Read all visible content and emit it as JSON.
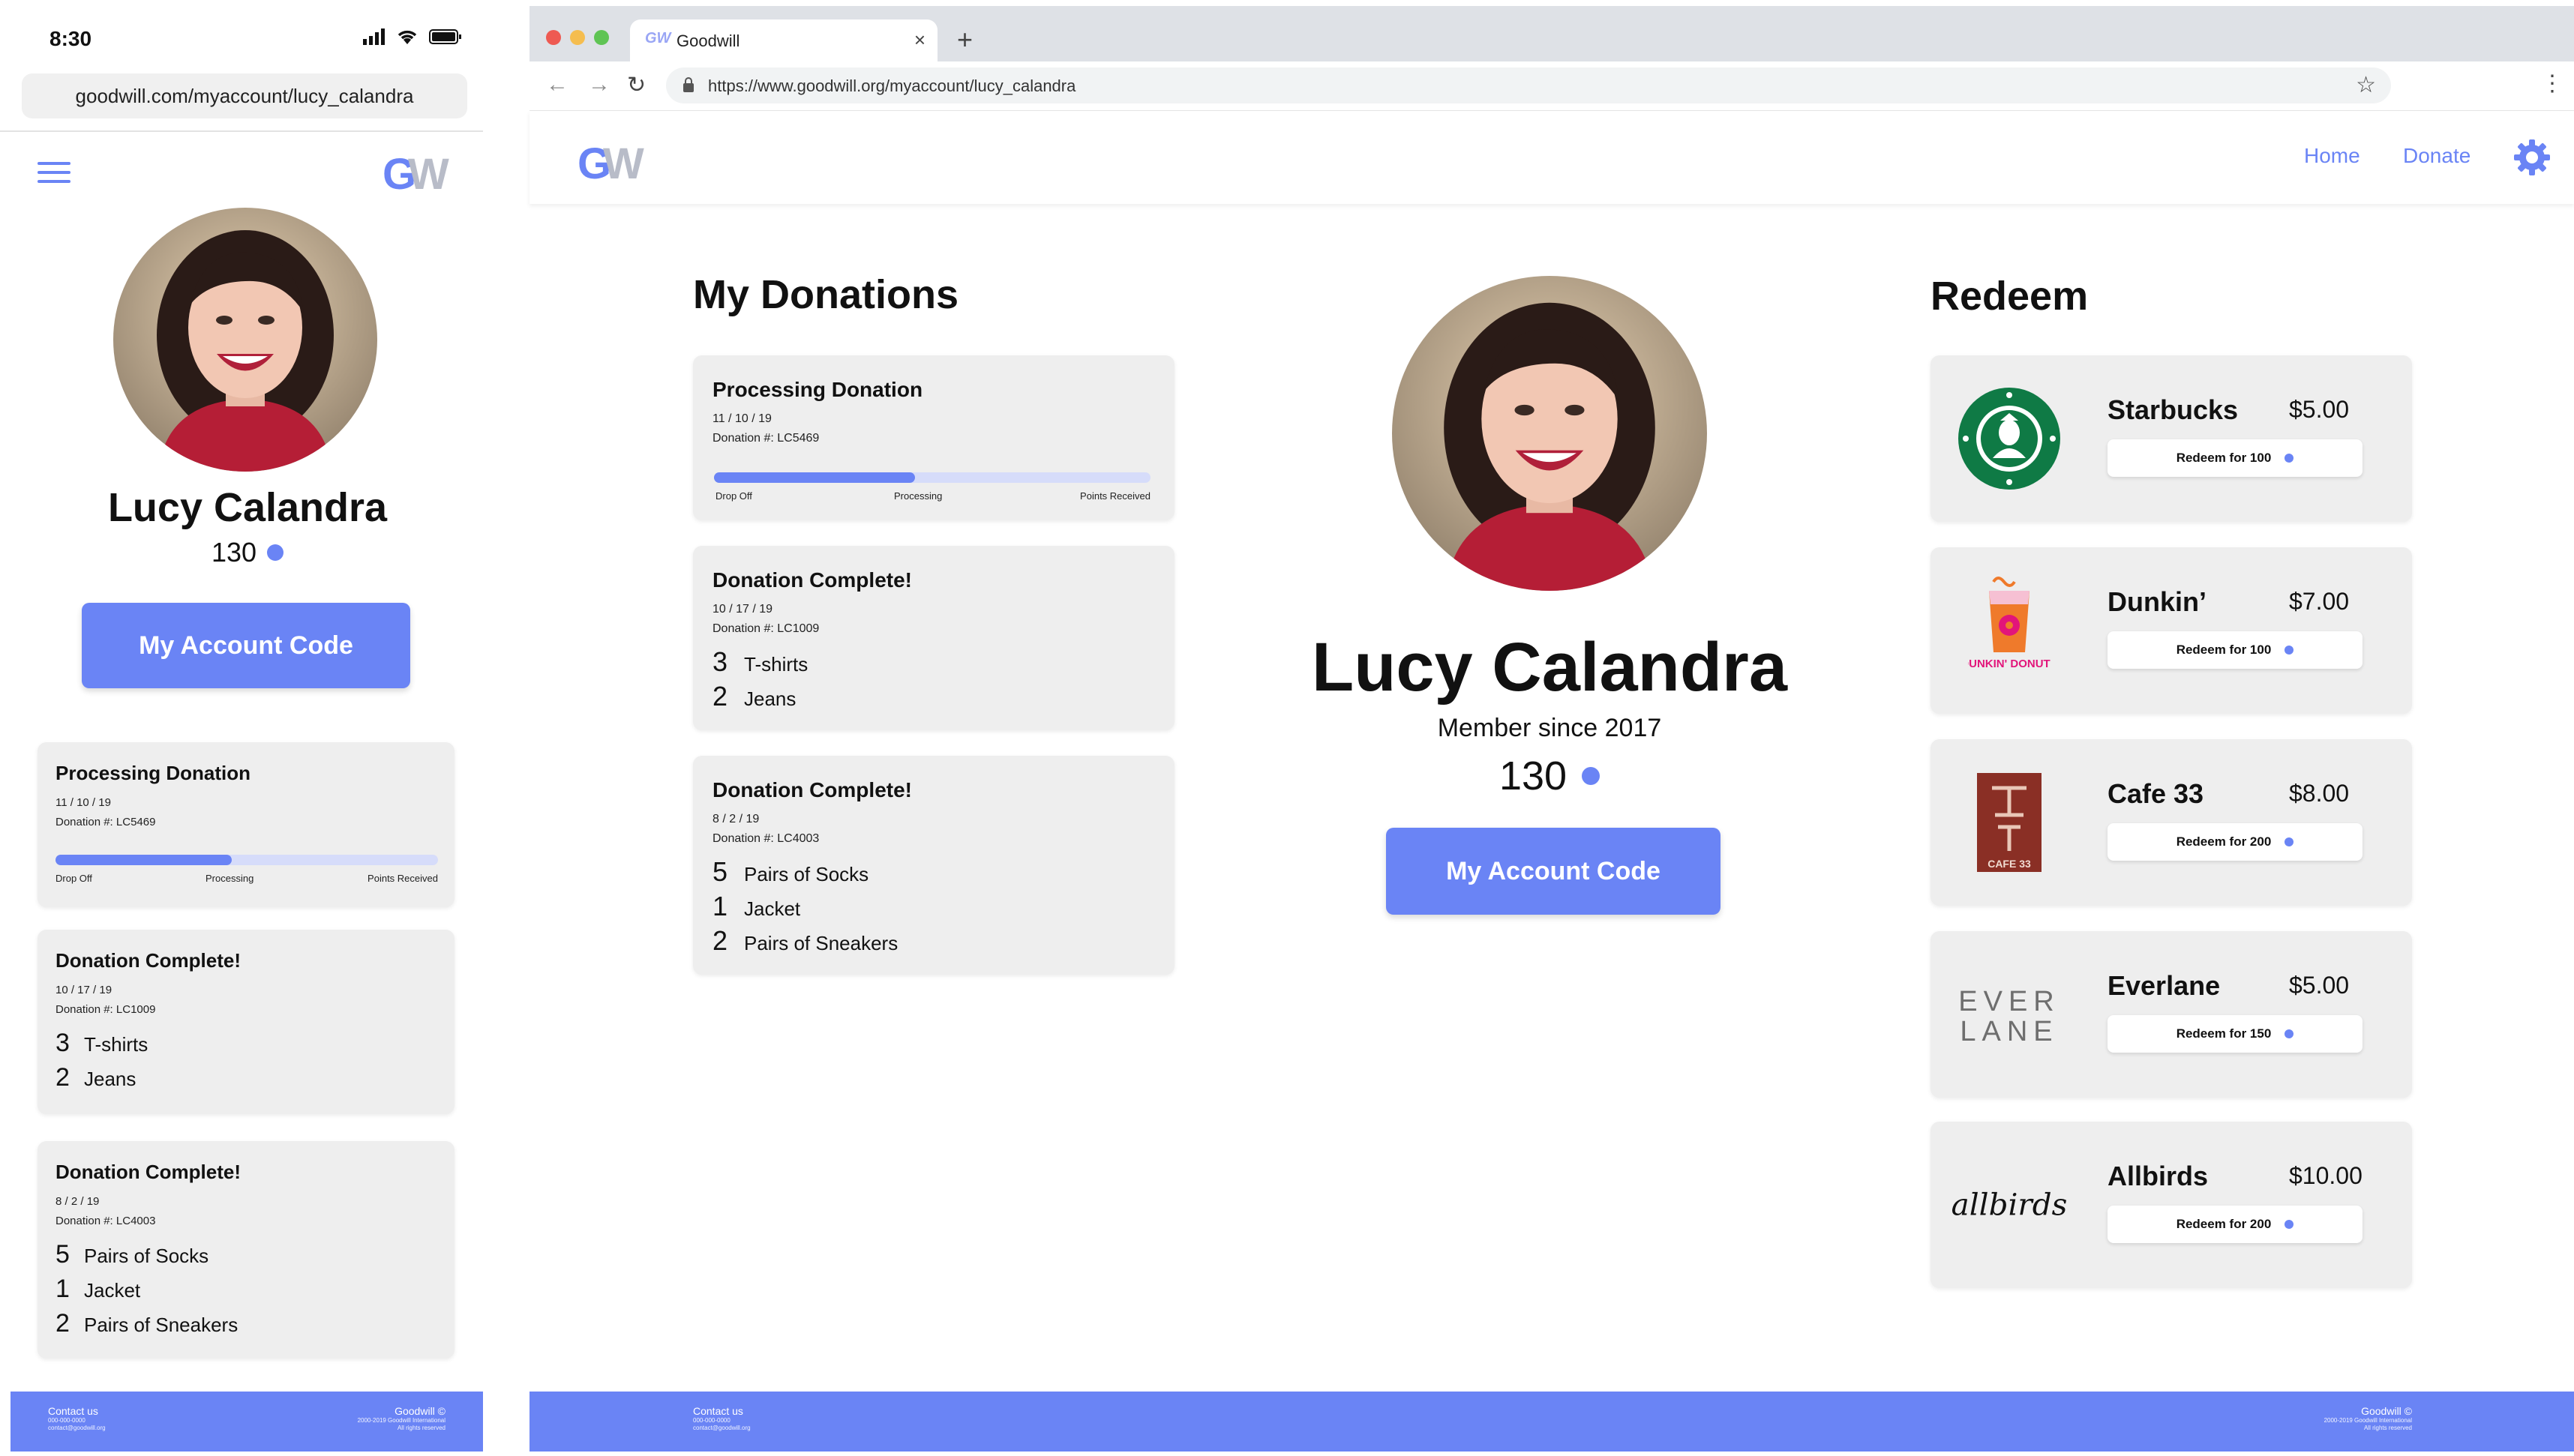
{
  "theme": {
    "accent": "#6a84f5",
    "card_bg": "#eeeeee",
    "footer_bg": "#6a84f5"
  },
  "mobile": {
    "status_time": "8:30",
    "url": "goodwill.com/myaccount/lucy_calandra",
    "logo_text": "GW",
    "user_name": "Lucy Calandra",
    "points": "130",
    "code_button": "My Account Code",
    "footer": {
      "contact_label": "Contact us",
      "contact_line1": "000-000-0000",
      "contact_line2": "contact@goodwill.org",
      "brand": "Goodwill ©",
      "fine1": "2000-2019 Goodwill International",
      "fine2": "All rights reserved"
    }
  },
  "browser": {
    "tab_title": "Goodwill",
    "tab_favicon": "GW",
    "url": "https://www.goodwill.org/myaccount/lucy_calandra"
  },
  "site": {
    "logo_text": "GW",
    "nav": {
      "home": "Home",
      "donate": "Donate"
    },
    "donations_heading": "My Donations",
    "redeem_heading": "Redeem",
    "user_name": "Lucy Calandra",
    "member_since": "Member since 2017",
    "points": "130",
    "code_button": "My Account Code",
    "footer": {
      "contact_label": "Contact us",
      "contact_line1": "000-000-0000",
      "contact_line2": "contact@goodwill.org",
      "brand": "Goodwill ©",
      "fine1": "2000-2019 Goodwill International",
      "fine2": "All rights reserved"
    }
  },
  "donations": [
    {
      "title": "Processing Donation",
      "date": "11 / 10 / 19",
      "number": "Donation #: LC5469",
      "progress_fraction": 0.46,
      "stages": [
        "Drop Off",
        "Processing",
        "Points Received"
      ],
      "items": []
    },
    {
      "title": "Donation Complete!",
      "date": "10 / 17 / 19",
      "number": "Donation #: LC1009",
      "items": [
        {
          "qty": "3",
          "name": "T-shirts"
        },
        {
          "qty": "2",
          "name": "Jeans"
        }
      ]
    },
    {
      "title": "Donation Complete!",
      "date": "8 / 2 / 19",
      "number": "Donation #: LC4003",
      "items": [
        {
          "qty": "5",
          "name": "Pairs of Socks"
        },
        {
          "qty": "1",
          "name": "Jacket"
        },
        {
          "qty": "2",
          "name": "Pairs of Sneakers"
        }
      ]
    }
  ],
  "rewards": [
    {
      "brand": "Starbucks",
      "price": "$5.00",
      "button": "Redeem for 100",
      "logo": "starbucks-logo"
    },
    {
      "brand": "Dunkin’",
      "price": "$7.00",
      "button": "Redeem for 100",
      "logo": "dunkin-logo",
      "logo_text": "DUNKIN' DONUTS"
    },
    {
      "brand": "Cafe 33",
      "price": "$8.00",
      "button": "Redeem for 200",
      "logo": "cafe33-logo",
      "logo_text": "CAFE 33"
    },
    {
      "brand": "Everlane",
      "price": "$5.00",
      "button": "Redeem for 150",
      "logo": "everlane-logo",
      "logo_text": "EVER LANE"
    },
    {
      "brand": "Allbirds",
      "price": "$10.00",
      "button": "Redeem for 200",
      "logo": "allbirds-logo",
      "logo_text": "allbirds"
    }
  ]
}
